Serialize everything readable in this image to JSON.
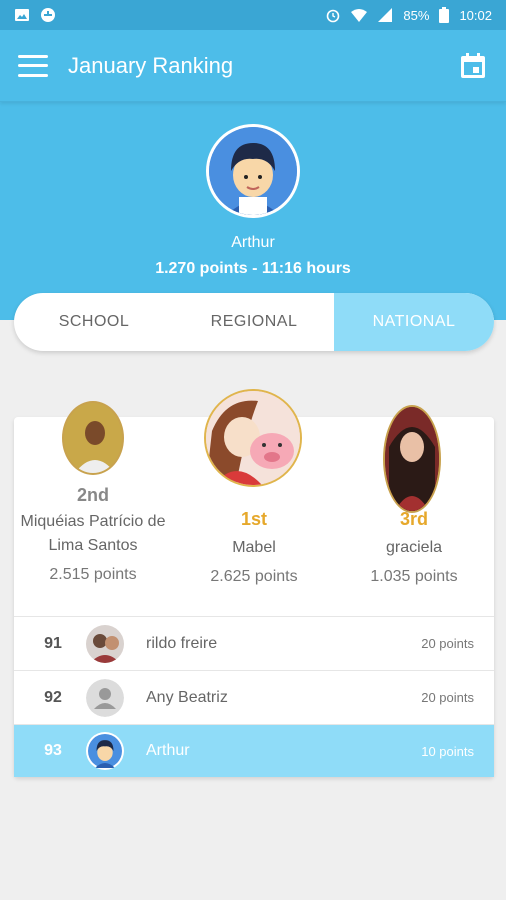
{
  "status": {
    "battery": "85%",
    "time": "10:02"
  },
  "appbar": {
    "title": "January Ranking"
  },
  "me": {
    "name": "Arthur",
    "stats": "1.270 points - 11:16 hours"
  },
  "tabs": [
    {
      "label": "SCHOOL",
      "active": false
    },
    {
      "label": "REGIONAL",
      "active": false
    },
    {
      "label": "NATIONAL",
      "active": true
    }
  ],
  "podium": {
    "second": {
      "rank": "2nd",
      "name": "Miquéias Patrício de Lima Santos",
      "points": "2.515 points"
    },
    "first": {
      "rank": "1st",
      "name": "Mabel",
      "points": "2.625 points"
    },
    "third": {
      "rank": "3rd",
      "name": "graciela",
      "points": "1.035 points"
    }
  },
  "ranking": [
    {
      "position": "91",
      "name": "rildo freire",
      "points": "20 points",
      "avatar": "user-photo"
    },
    {
      "position": "92",
      "name": "Any Beatriz",
      "points": "20 points",
      "avatar": "default-avatar"
    },
    {
      "position": "93",
      "name": "Arthur",
      "points": "10 points",
      "avatar": "boy-avatar",
      "current_user": true
    }
  ],
  "colors": {
    "primary": "#4dbde9",
    "status_bar": "#3aa6d4",
    "active_tab": "#8fdcf8",
    "gold_rank": "#e6a82b",
    "silver_rank": "#888888"
  }
}
